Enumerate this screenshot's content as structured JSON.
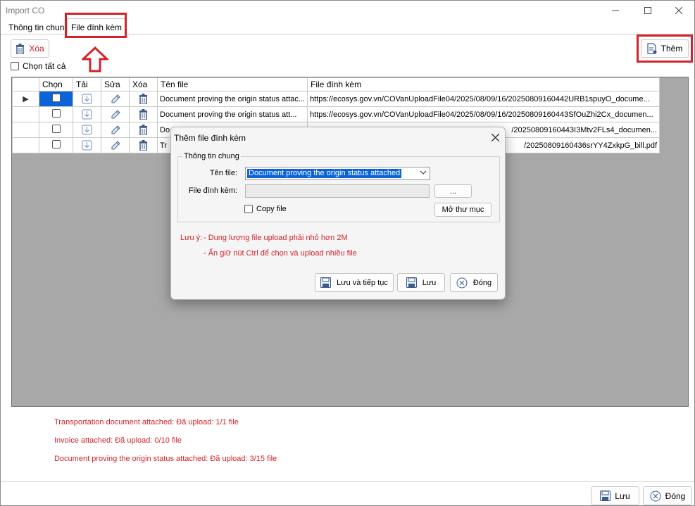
{
  "window": {
    "title": "Import CO"
  },
  "tabs": [
    {
      "label": "Thông tin chung"
    },
    {
      "label": "File đính kèm"
    }
  ],
  "toolbar": {
    "delete_label": "Xóa",
    "select_all_label": "Chọn tất cả",
    "add_label": "Thêm"
  },
  "grid": {
    "columns": [
      "Chọn",
      "Tải",
      "Sửa",
      "Xóa",
      "Tên file",
      "File đính kèm"
    ],
    "rows": [
      {
        "name": "Document proving the origin status attac...",
        "url": "https://ecosys.gov.vn/COVanUploadFile04/2025/08/09/16/20250809160442URB1spuyO_docume..."
      },
      {
        "name": "Document proving the origin status att...",
        "url": "https://ecosys.gov.vn/COVanUploadFile04/2025/08/09/16/20250809160443SfOuZhi2Cx_documen..."
      },
      {
        "name": "Do",
        "url": "/20250809160443I3Mtv2FLs4_documen..."
      },
      {
        "name": "Tr",
        "url": "/20250809160436srYY4ZxkpG_bill.pdf"
      }
    ]
  },
  "status": [
    "Transportation document attached: Đã upload: 1/1 file",
    "Invoice attached: Đã upload: 0/10 file",
    "Document proving the origin status attached: Đã upload: 3/15 file"
  ],
  "footer": {
    "save_label": "Lưu",
    "close_label": "Đóng"
  },
  "dialog": {
    "title": "Thêm file đính kèm",
    "group_label": "Thông tin chung",
    "filename_label": "Tên file:",
    "filename_value": "Document proving the origin status attached",
    "attachment_label": "File đính kèm:",
    "attachment_value": "",
    "browse_label": "...",
    "copy_label": "Copy file",
    "open_folder_label": "Mở thư mục",
    "note_prefix": "Lưu ý:",
    "note_1": "- Dung lượng file upload phải nhỏ hơn 2M",
    "note_2": "- Ấn giữ nút Ctrl để chọn và upload nhiều file",
    "save_continue_label": "Lưu và tiếp tục",
    "save_label": "Lưu",
    "close_label": "Đóng"
  },
  "colors": {
    "accent_red": "#d2232a",
    "selection_blue": "#0a64d8",
    "grid_background": "#a8a8a8"
  }
}
